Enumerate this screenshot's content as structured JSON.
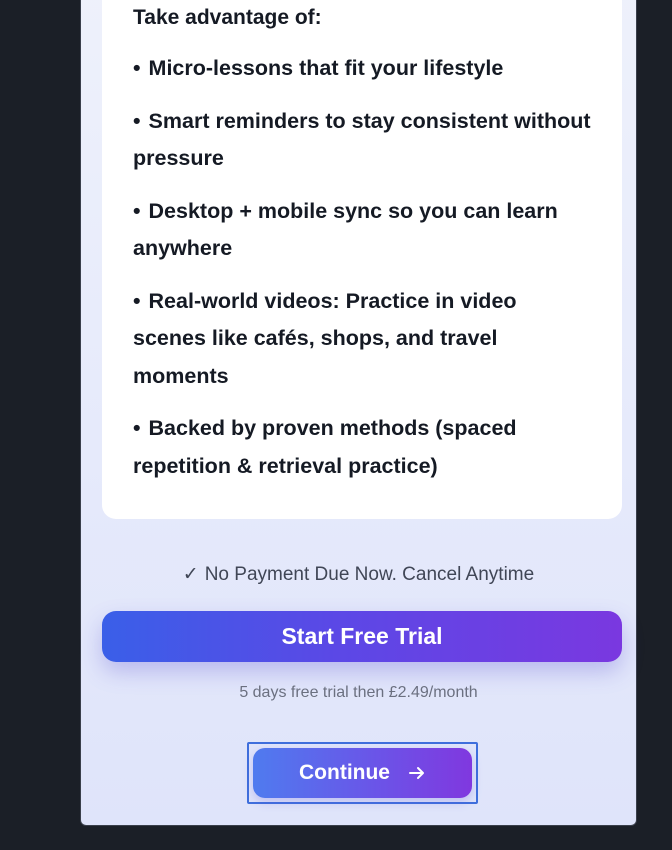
{
  "benefits": {
    "heading": "Take advantage of:",
    "bullet": "•",
    "items": [
      "Micro-lessons that fit your lifestyle",
      "Smart reminders to stay consistent without pressure",
      "Desktop + mobile sync so you can learn anywhere",
      "Real-world videos: Practice in video scenes like cafés, shops, and travel moments",
      "Backed by proven methods (spaced repetition & retrieval practice)"
    ]
  },
  "payment_note": {
    "icon": "checkmark-icon",
    "check": "✓",
    "text": "No Payment Due Now. Cancel Anytime"
  },
  "cta": {
    "trial_label": "Start Free Trial",
    "terms": "5 days free trial then £2.49/month",
    "continue_label": "Continue",
    "continue_icon": "arrow-right-icon"
  },
  "colors": {
    "background": "#1b1f27",
    "panel": "#e6eafb",
    "card": "#ffffff",
    "accent_start": "#3a5fe8",
    "accent_end": "#7a38e0",
    "focus_ring": "#3f6fdc",
    "text_primary": "#151a24"
  }
}
